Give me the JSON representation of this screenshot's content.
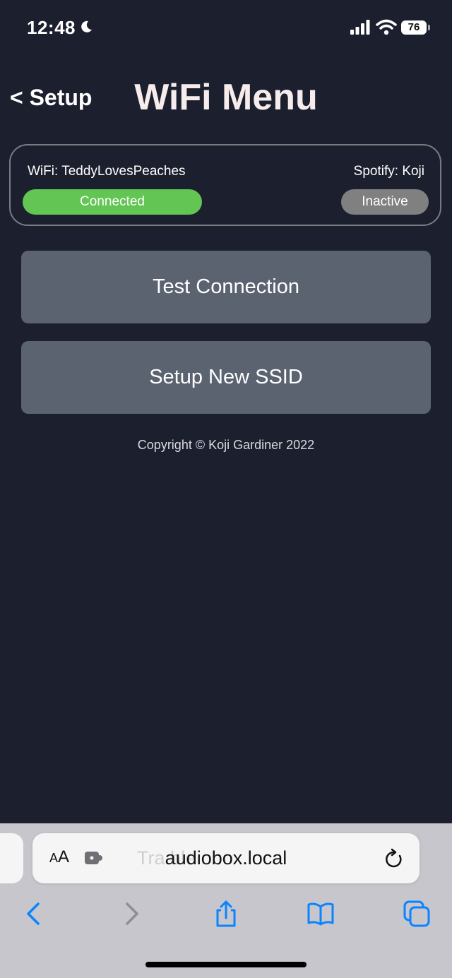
{
  "status_bar": {
    "time": "12:48",
    "battery": "76"
  },
  "header": {
    "back_label": "< Setup",
    "title": "WiFi Menu"
  },
  "status_card": {
    "wifi_label": "WiFi: TeddyLovesPeaches",
    "wifi_status": "Connected",
    "spotify_label": "Spotify: Koji",
    "spotify_status": "Inactive"
  },
  "actions": {
    "test_connection": "Test Connection",
    "setup_ssid": "Setup New SSID"
  },
  "footer": {
    "copyright": "Copyright © Koji Gardiner 2022"
  },
  "browser": {
    "aa_label_small": "A",
    "aa_label_big": "A",
    "url": "audiobox.local",
    "ghost_text": "Tra                    ble"
  },
  "colors": {
    "background": "#1c1f2e",
    "connected": "#62c554",
    "inactive": "#808080",
    "button": "#5b6370",
    "ios_blue": "#0a84ff"
  },
  "icons": [
    "moon-icon",
    "signal-icon",
    "wifi-icon",
    "battery-icon",
    "extension-icon",
    "reload-icon",
    "back-arrow-icon",
    "forward-arrow-icon",
    "share-icon",
    "bookmarks-icon",
    "tabs-icon"
  ]
}
